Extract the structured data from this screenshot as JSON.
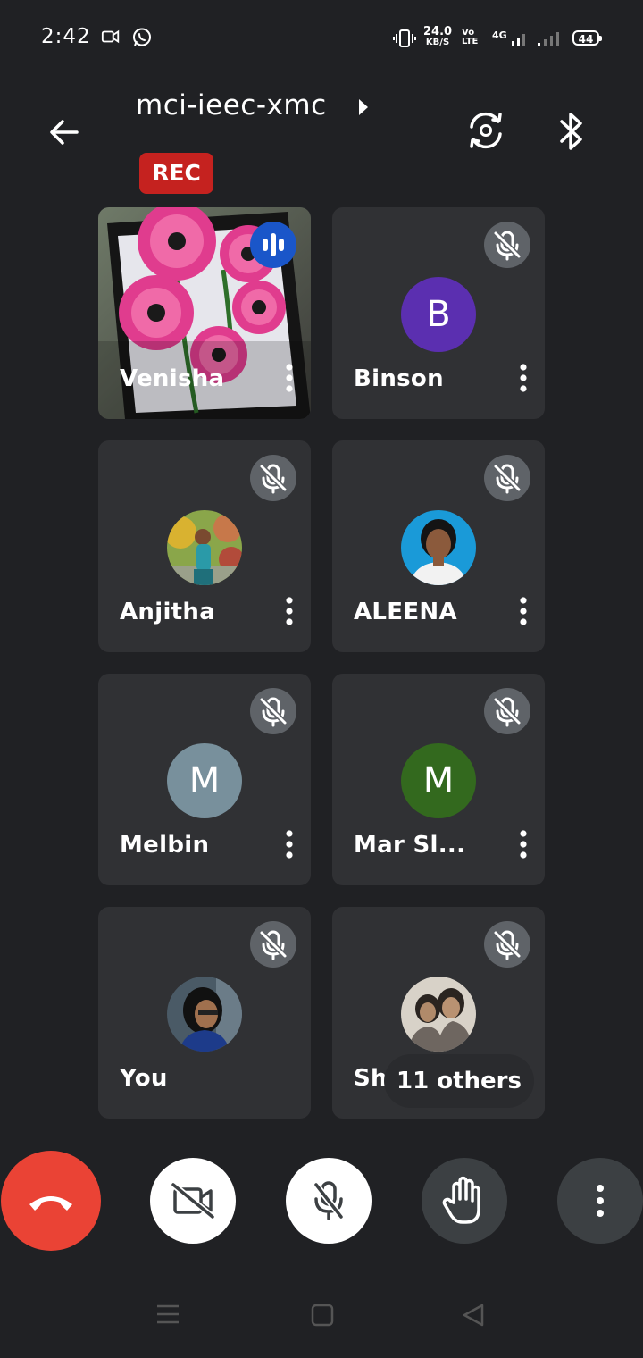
{
  "status_bar": {
    "time": "2:42",
    "net_speed_value": "24.0",
    "net_speed_unit": "KB/S",
    "volte_top": "Vo",
    "volte_bottom": "LTE",
    "network_type": "4G",
    "battery": "44",
    "icons": [
      "video-camera-icon",
      "whatsapp-icon",
      "vibrate-icon",
      "signal-icon",
      "signal-icon"
    ]
  },
  "header": {
    "meeting_code": "mci-ieec-xmc",
    "rec_label": "REC",
    "icons": [
      "back-arrow-icon",
      "caret-right-icon",
      "switch-camera-icon",
      "bluetooth-icon"
    ]
  },
  "participants": [
    {
      "name": "Venisha",
      "state": "speaking",
      "avatar": "video"
    },
    {
      "name": "Binson",
      "state": "muted",
      "avatar_letter": "B",
      "avatar_color": "#5b2fb0"
    },
    {
      "name": "Anjitha",
      "state": "muted",
      "avatar": "photo"
    },
    {
      "name": "ALEENA",
      "state": "muted",
      "avatar": "photo"
    },
    {
      "name": "Melbin",
      "state": "muted",
      "avatar_letter": "M",
      "avatar_color": "#78909c"
    },
    {
      "name": "Mar Sl...",
      "state": "muted",
      "avatar_letter": "M",
      "avatar_color": "#33691e"
    },
    {
      "name": "You",
      "state": "muted",
      "avatar": "photo"
    },
    {
      "name": "Shi",
      "state": "muted",
      "avatar": "photo"
    }
  ],
  "others_pill": "11 others",
  "controls": [
    "end-call-icon",
    "video-off-icon",
    "mic-off-icon",
    "raise-hand-icon",
    "more-vert-icon"
  ],
  "colors": {
    "background": "#202124",
    "tile": "#303134",
    "end_call": "#ea4335",
    "rec": "#c5221f",
    "speaking": "#1a56c9"
  }
}
